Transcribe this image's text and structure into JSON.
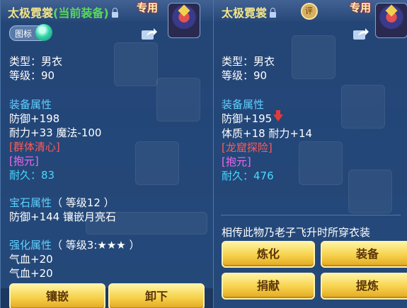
{
  "colors": {
    "title": "#f2e48a",
    "current": "#59d95c",
    "header": "#5fd0ff",
    "red": "#ff5a5a",
    "pink": "#f068f0",
    "cyan": "#4ad8ff",
    "button": "#f6d04a"
  },
  "left": {
    "name": "太极霓裳",
    "current_tag": "(当前装备)",
    "exclusive": "专用",
    "badge_label": "图标",
    "type": "类型：男衣",
    "level": "等级：90",
    "equip_header": "装备属性",
    "defense": "防御+198",
    "stats": "耐力+33 魔法-100",
    "special": "[群体清心]",
    "special2": "[抱元]",
    "durability": "耐久：83",
    "gem_header": "宝石属性",
    "gem_level": "（ 等级12 ）",
    "gem_stats": "防御+144 镶嵌月亮石",
    "enhance_header": "强化属性",
    "enhance_level": "（ 等级3:★★★ ）",
    "enhance_1": "气血+20",
    "enhance_2": "气血+20",
    "buttons": {
      "inlay": "镶嵌",
      "unequip": "卸下"
    }
  },
  "right": {
    "name": "太极霓裳",
    "exclusive": "专用",
    "seal": "评",
    "type": "类型：男衣",
    "level": "等级：90",
    "equip_header": "装备属性",
    "defense": "防御+195",
    "stats": "体质+18 耐力+14",
    "special": "[龙窟探险]",
    "special2": "[抱元]",
    "durability": "耐久：476",
    "description": "相传此物乃老子飞升时所穿衣装",
    "buttons": {
      "refine": "炼化",
      "equip": "装备",
      "donate": "捐献",
      "purify": "提炼"
    }
  }
}
